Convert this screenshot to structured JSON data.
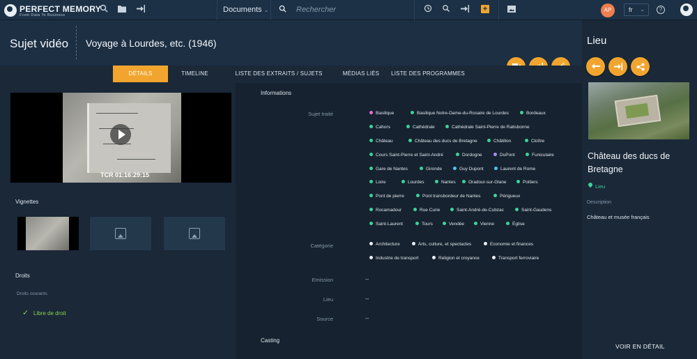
{
  "topbar": {
    "logo_title": "PERFECT MEMORY",
    "logo_tagline": "From Data To Business",
    "documents_label": "Documents",
    "search_placeholder": "Rechercher",
    "avatar_initials": "AP",
    "language": "fr"
  },
  "header": {
    "title": "Sujet vidéo",
    "subtitle": "Voyage à Lourdes, etc. (1946)"
  },
  "tabs": [
    {
      "label": "DÉTAILS"
    },
    {
      "label": "TIMELINE"
    },
    {
      "label": "LISTE DES EXTRAITS / SUJETS UTILISÉS"
    },
    {
      "label": "MÉDIAS LIÉS"
    },
    {
      "label": "LISTE DES PROGRAMMES"
    }
  ],
  "video": {
    "timecode": "TCR 01:16:29:15"
  },
  "left": {
    "thumbnails_label": "Vignettes",
    "rights_label": "Droits",
    "rights_current_label": "Droits courants",
    "rights_value": "Libre de droit"
  },
  "info": {
    "section_title": "Informations",
    "subject_label": "Sujet traité",
    "subjects": [
      {
        "label": "Basilique",
        "color": "#e76fd1"
      },
      {
        "label": "Basilique Notre-Dame-du-Rosaire de Lourdes",
        "color": "#3bd39c"
      },
      {
        "label": "Bordeaux",
        "color": "#3bd39c"
      },
      {
        "label": "Cahors",
        "color": "#3bd39c"
      },
      {
        "label": "Cathédrale",
        "color": "#3bd39c"
      },
      {
        "label": "Cathédrale Saint-Pierre de Ratisbonne",
        "color": "#3bd39c"
      },
      {
        "label": "Château",
        "color": "#3bd39c"
      },
      {
        "label": "Château des ducs de Bretagne",
        "color": "#3bd39c"
      },
      {
        "label": "Châtillon",
        "color": "#3bd39c"
      },
      {
        "label": "Cloître",
        "color": "#3bd39c"
      },
      {
        "label": "Cours Saint-Pierre et Saint-André",
        "color": "#3bd39c"
      },
      {
        "label": "Dordogne",
        "color": "#3bd39c"
      },
      {
        "label": "DuPont",
        "color": "#a88ef0"
      },
      {
        "label": "Funiculaire",
        "color": "#3bd39c"
      },
      {
        "label": "Gare de Nantes",
        "color": "#3bd39c"
      },
      {
        "label": "Gironde",
        "color": "#3bd39c"
      },
      {
        "label": "Guy Dupont",
        "color": "#49c6f0"
      },
      {
        "label": "Laurent de Rome",
        "color": "#49c6f0"
      },
      {
        "label": "Loire",
        "color": "#3bd39c"
      },
      {
        "label": "Lourdes",
        "color": "#3bd39c"
      },
      {
        "label": "Nantes",
        "color": "#3bd39c"
      },
      {
        "label": "Oradour-sur-Glane",
        "color": "#3bd39c"
      },
      {
        "label": "Poitiers",
        "color": "#3bd39c"
      },
      {
        "label": "Pont de pierre",
        "color": "#3bd39c"
      },
      {
        "label": "Pont transbordeur de Nantes",
        "color": "#3bd39c"
      },
      {
        "label": "Périgueux",
        "color": "#3bd39c"
      },
      {
        "label": "Rocamadour",
        "color": "#3bd39c"
      },
      {
        "label": "Rue Curie",
        "color": "#3bd39c"
      },
      {
        "label": "Saint-André-de-Cubzac",
        "color": "#3bd39c"
      },
      {
        "label": "Saint-Gaudens",
        "color": "#3bd39c"
      },
      {
        "label": "Saint-Laurent",
        "color": "#3bd39c"
      },
      {
        "label": "Tours",
        "color": "#3bd39c"
      },
      {
        "label": "Vendée",
        "color": "#3bd39c"
      },
      {
        "label": "Vienne",
        "color": "#3bd39c"
      },
      {
        "label": "Église",
        "color": "#3bd39c"
      }
    ],
    "category_label": "Catégorie",
    "categories": [
      {
        "label": "Architecture",
        "color": "#e8eef3"
      },
      {
        "label": "Arts, culture, et spectacles",
        "color": "#e8eef3"
      },
      {
        "label": "Economie et finances",
        "color": "#e8eef3"
      },
      {
        "label": "Industrie de transport",
        "color": "#e8eef3"
      },
      {
        "label": "Religion et croyance",
        "color": "#e8eef3"
      },
      {
        "label": "Transport ferroviaire",
        "color": "#e8eef3"
      }
    ],
    "emission_label": "Emission",
    "emission_value": "--",
    "lieu_label": "Lieu",
    "lieu_value": "--",
    "source_label": "Source",
    "source_value": "--",
    "casting_title": "Casting"
  },
  "right": {
    "title": "Lieu",
    "place_name": "Château des ducs de Bretagne",
    "type_label": "Lieu",
    "description_label": "Description",
    "description": "Château et musée français",
    "more_label": "VOIR EN DÉTAIL"
  },
  "colors": {
    "accent": "#f2a52e",
    "place": "#3bd39c",
    "rights_ok": "#8bd24f"
  }
}
